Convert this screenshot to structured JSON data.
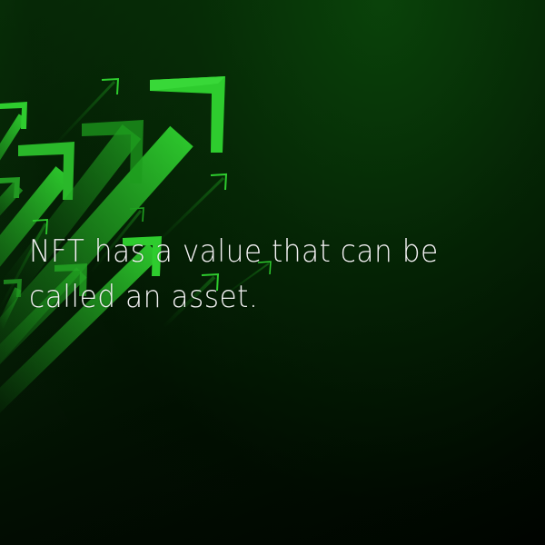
{
  "headline": "NFT has a value that can be called an asset.",
  "colors": {
    "background_top": "#0a3a0a",
    "background_bottom": "#000000",
    "arrow_bright": "#2ecc2e",
    "arrow_dim": "#1a8a1a",
    "text": "#f2f2f2"
  },
  "decoration": {
    "icon": "rising-arrows-icon"
  }
}
